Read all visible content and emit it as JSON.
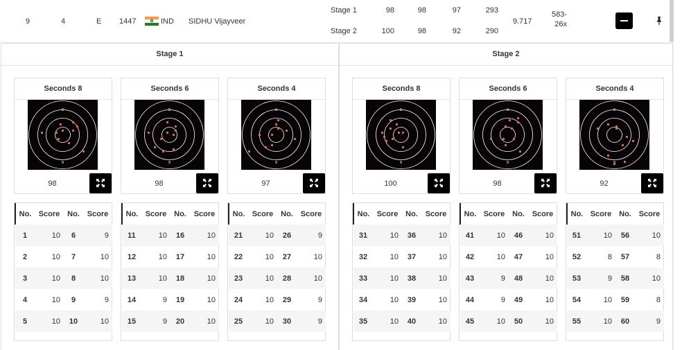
{
  "athlete": {
    "rank": "9",
    "relay": "4",
    "target": "E",
    "bib": "1447",
    "nation": "IND",
    "name": "SIDHU Vijayveer",
    "average": "9.717",
    "total_line1": "583-",
    "total_line2": "26x",
    "flag_colors": [
      "#ff9933",
      "#ffffff",
      "#138808"
    ],
    "stages": [
      {
        "label": "Stage 1",
        "values": [
          "98",
          "98",
          "97",
          "293"
        ]
      },
      {
        "label": "Stage 2",
        "values": [
          "100",
          "98",
          "92",
          "290"
        ]
      }
    ],
    "collapse_icon": "minus-icon",
    "pin_icon": "pushpin-icon"
  },
  "stage_panels": [
    {
      "title": "Stage 1",
      "series": [
        {
          "title": "Seconds 8",
          "score": "98",
          "ring_label": "9",
          "shots": [
            [
              0.83,
              0.82
            ],
            [
              0.9,
              0.78
            ],
            [
              0.82,
              0.79
            ],
            [
              0.75,
              0.79
            ],
            [
              0.92,
              0.76
            ],
            [
              0.84,
              0.75
            ],
            [
              0.85,
              0.78
            ],
            [
              0.88,
              0.84
            ],
            [
              0.9,
              0.74
            ],
            [
              0.95,
              0.88
            ]
          ]
        },
        {
          "title": "Seconds 6",
          "score": "98",
          "ring_label": "9",
          "shots": [
            [
              0.84,
              0.79
            ],
            [
              0.87,
              0.8
            ],
            [
              0.88,
              0.78
            ],
            [
              0.88,
              0.76
            ],
            [
              0.84,
              0.74
            ],
            [
              0.78,
              0.86
            ],
            [
              0.75,
              0.79
            ],
            [
              0.81,
              0.82
            ],
            [
              0.82,
              0.88
            ],
            [
              0.87,
              0.87
            ]
          ]
        },
        {
          "title": "Seconds 4",
          "score": "97",
          "ring_label": "9",
          "shots": [
            [
              0.83,
              0.8
            ],
            [
              0.77,
              0.8
            ],
            [
              0.85,
              0.75
            ],
            [
              0.86,
              0.73
            ],
            [
              0.86,
              0.77
            ],
            [
              0.9,
              0.78
            ],
            [
              0.8,
              0.86
            ],
            [
              0.94,
              0.82
            ],
            [
              0.72,
              0.88
            ],
            [
              0.83,
              0.85
            ]
          ]
        }
      ],
      "shots": [
        [
          [
            "1",
            "10"
          ],
          [
            "6",
            "9"
          ]
        ],
        [
          [
            "2",
            "10"
          ],
          [
            "7",
            "10"
          ]
        ],
        [
          [
            "3",
            "10"
          ],
          [
            "8",
            "10"
          ]
        ],
        [
          [
            "4",
            "10"
          ],
          [
            "9",
            "9"
          ]
        ],
        [
          [
            "5",
            "10"
          ],
          [
            "10",
            "10"
          ]
        ],
        [
          [
            "11",
            "10"
          ],
          [
            "16",
            "10"
          ]
        ],
        [
          [
            "12",
            "10"
          ],
          [
            "17",
            "10"
          ]
        ],
        [
          [
            "13",
            "10"
          ],
          [
            "18",
            "10"
          ]
        ],
        [
          [
            "14",
            "9"
          ],
          [
            "19",
            "10"
          ]
        ],
        [
          [
            "15",
            "9"
          ],
          [
            "20",
            "10"
          ]
        ],
        [
          [
            "21",
            "10"
          ],
          [
            "26",
            "9"
          ]
        ],
        [
          [
            "22",
            "10"
          ],
          [
            "27",
            "10"
          ]
        ],
        [
          [
            "23",
            "10"
          ],
          [
            "28",
            "10"
          ]
        ],
        [
          [
            "24",
            "10"
          ],
          [
            "29",
            "9"
          ]
        ],
        [
          [
            "25",
            "10"
          ],
          [
            "30",
            "9"
          ]
        ]
      ]
    },
    {
      "title": "Stage 2",
      "series": [
        {
          "title": "Seconds 8",
          "score": "100",
          "ring_label": "9",
          "shots": [
            [
              0.8,
              0.77
            ],
            [
              0.77,
              0.81
            ],
            [
              0.84,
              0.79
            ],
            [
              0.86,
              0.79
            ],
            [
              0.78,
              0.83
            ],
            [
              0.81,
              0.82
            ],
            [
              0.83,
              0.75
            ],
            [
              0.8,
              0.73
            ],
            [
              0.76,
              0.79
            ],
            [
              0.86,
              0.86
            ]
          ]
        },
        {
          "title": "Seconds 6",
          "score": "98",
          "ring_label": "9",
          "shots": [
            [
              0.84,
              0.76
            ],
            [
              0.87,
              0.77
            ],
            [
              0.86,
              0.73
            ],
            [
              0.88,
              0.82
            ],
            [
              0.77,
              0.82
            ],
            [
              0.9,
              0.74
            ],
            [
              0.9,
              0.72
            ],
            [
              0.83,
              0.82
            ],
            [
              0.84,
              0.85
            ],
            [
              0.91,
              0.88
            ]
          ]
        },
        {
          "title": "Seconds 4",
          "score": "92",
          "ring_label": "9",
          "shots": [
            [
              0.82,
              0.75
            ],
            [
              0.86,
              0.76
            ],
            [
              0.77,
              0.77
            ],
            [
              0.94,
              0.83
            ],
            [
              0.89,
              0.85
            ],
            [
              0.86,
              0.77
            ],
            [
              0.91,
              0.81
            ],
            [
              0.82,
              0.9
            ],
            [
              0.85,
              0.94
            ],
            [
              0.9,
              0.93
            ]
          ]
        }
      ],
      "shots": [
        [
          [
            "31",
            "10"
          ],
          [
            "36",
            "10"
          ]
        ],
        [
          [
            "32",
            "10"
          ],
          [
            "37",
            "10"
          ]
        ],
        [
          [
            "33",
            "10"
          ],
          [
            "38",
            "10"
          ]
        ],
        [
          [
            "34",
            "10"
          ],
          [
            "39",
            "10"
          ]
        ],
        [
          [
            "35",
            "10"
          ],
          [
            "40",
            "10"
          ]
        ],
        [
          [
            "41",
            "10"
          ],
          [
            "46",
            "10"
          ]
        ],
        [
          [
            "42",
            "10"
          ],
          [
            "47",
            "10"
          ]
        ],
        [
          [
            "43",
            "9"
          ],
          [
            "48",
            "10"
          ]
        ],
        [
          [
            "44",
            "9"
          ],
          [
            "49",
            "10"
          ]
        ],
        [
          [
            "45",
            "10"
          ],
          [
            "50",
            "10"
          ]
        ],
        [
          [
            "51",
            "10"
          ],
          [
            "56",
            "10"
          ]
        ],
        [
          [
            "52",
            "8"
          ],
          [
            "57",
            "8"
          ]
        ],
        [
          [
            "53",
            "9"
          ],
          [
            "58",
            "10"
          ]
        ],
        [
          [
            "54",
            "10"
          ],
          [
            "59",
            "8"
          ]
        ],
        [
          [
            "55",
            "10"
          ],
          [
            "60",
            "9"
          ]
        ]
      ]
    }
  ],
  "table_headers": [
    "No.",
    "Score",
    "No.",
    "Score"
  ],
  "icons": {
    "expand": "expand-arrows-icon",
    "target": "target-icon"
  },
  "colors": {
    "shot": "#e8772e",
    "target_bg": "#080304",
    "ring": "#ffffff",
    "button": "#000000"
  }
}
